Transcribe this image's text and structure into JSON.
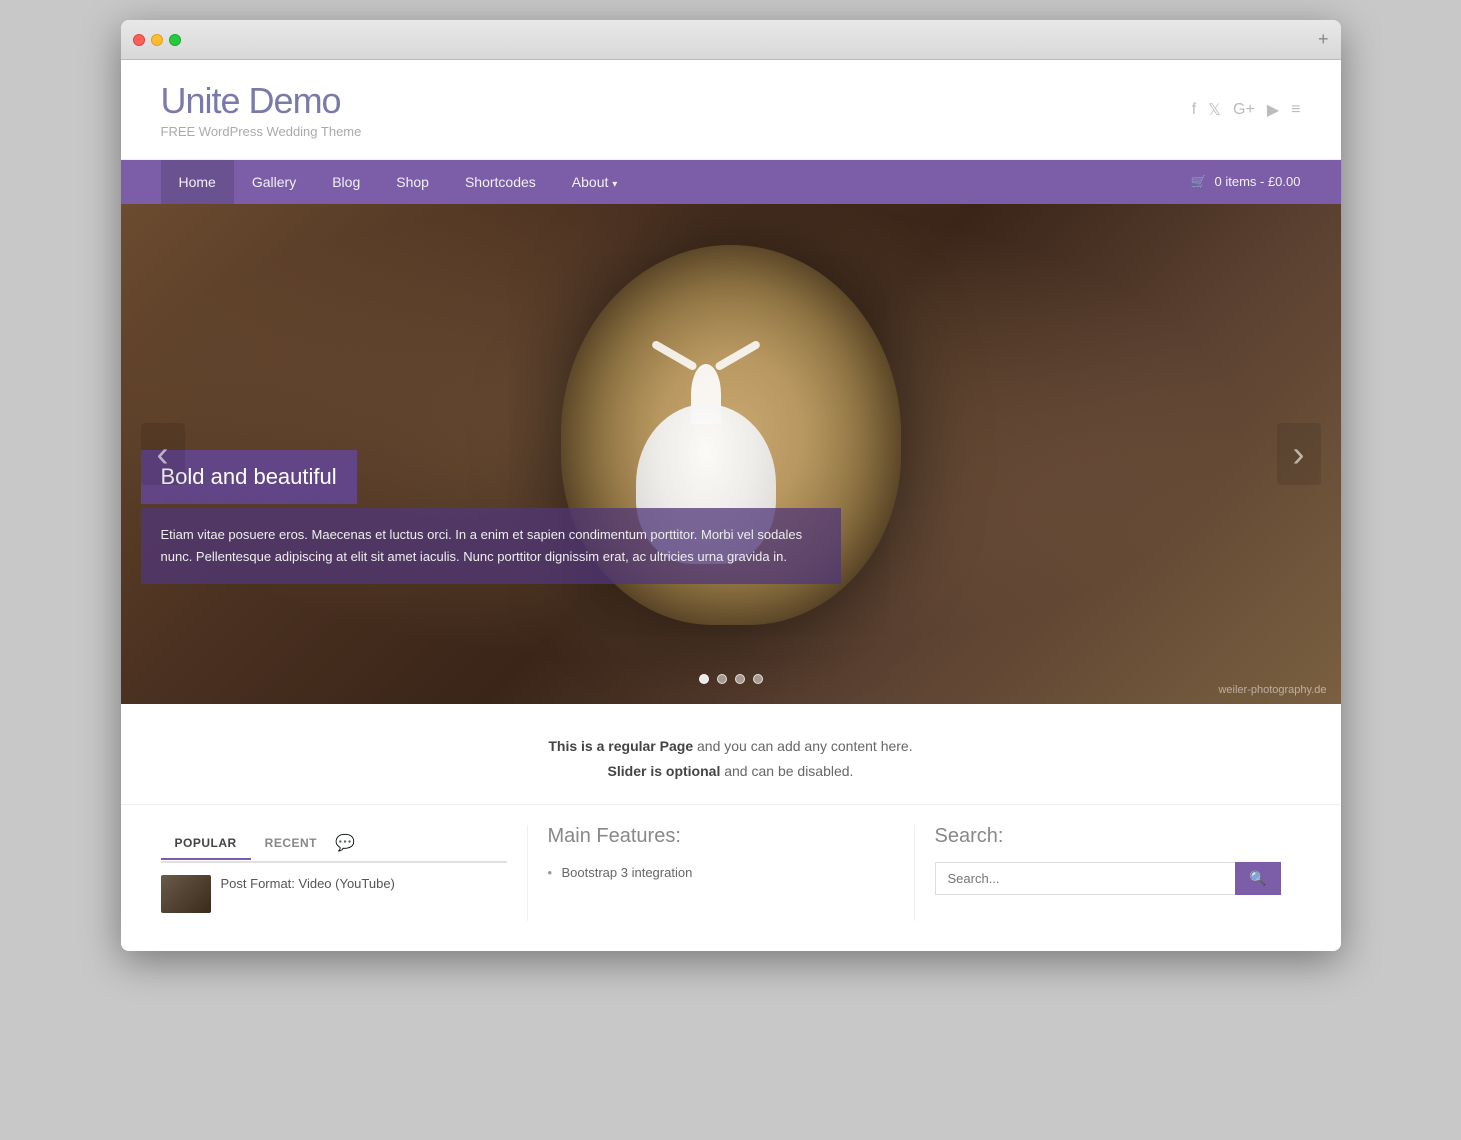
{
  "browser": {
    "add_tab_label": "+"
  },
  "header": {
    "site_title": "Unite Demo",
    "site_description": "FREE WordPress Wedding Theme",
    "social_icons": [
      "f",
      "t",
      "g+",
      "▶",
      "≡"
    ]
  },
  "nav": {
    "items": [
      {
        "label": "Home",
        "active": true
      },
      {
        "label": "Gallery",
        "active": false
      },
      {
        "label": "Blog",
        "active": false
      },
      {
        "label": "Shop",
        "active": false
      },
      {
        "label": "Shortcodes",
        "active": false
      },
      {
        "label": "About",
        "active": false,
        "has_dropdown": true
      }
    ],
    "cart_label": "0 items - £0.00"
  },
  "slider": {
    "slide_title": "Bold and beautiful",
    "slide_text": "Etiam vitae posuere eros. Maecenas et luctus orci. In a enim et sapien condimentum porttitor. Morbi vel sodales nunc. Pellentesque adipiscing at elit sit amet iaculis. Nunc porttitor dignissim erat, ac ultricies urna gravida in.",
    "prev_label": "‹",
    "next_label": "›",
    "photo_credit": "weiler-photography.de",
    "dots": [
      {
        "active": true
      },
      {
        "active": false
      },
      {
        "active": false
      },
      {
        "active": false
      }
    ]
  },
  "page_description": {
    "line1_bold": "This is a regular Page",
    "line1_rest": " and you can add any content here.",
    "line2_bold": "Slider is optional",
    "line2_rest": " and can be disabled."
  },
  "tabs_widget": {
    "tabs": [
      {
        "label": "Popular",
        "active": true
      },
      {
        "label": "Recent",
        "active": false
      }
    ],
    "posts": [
      {
        "title": "Post Format: Video (YouTube)"
      }
    ]
  },
  "features_widget": {
    "heading": "Main Features:",
    "items": [
      "Bootstrap 3 integration"
    ]
  },
  "search_widget": {
    "heading": "Search:",
    "placeholder": "Search...",
    "button_label": "🔍"
  }
}
